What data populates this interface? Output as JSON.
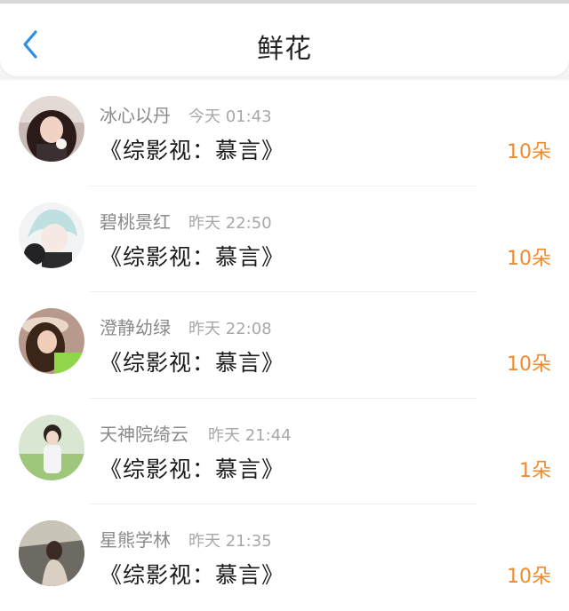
{
  "header": {
    "title": "鲜花",
    "back_icon": "chevron-left-icon",
    "accent": "#2e8ee8"
  },
  "count_color": "#f08a2a",
  "rows": [
    {
      "name": "冰心以丹",
      "time": "今天 01:43",
      "book": "《综影视：慕言》",
      "count": "10朵",
      "avatar": "avatar-icon"
    },
    {
      "name": "碧桃景红",
      "time": "昨天 22:50",
      "book": "《综影视：慕言》",
      "count": "10朵",
      "avatar": "avatar-icon"
    },
    {
      "name": "澄静幼绿",
      "time": "昨天 22:08",
      "book": "《综影视：慕言》",
      "count": "10朵",
      "avatar": "avatar-icon"
    },
    {
      "name": "天神院绮云",
      "time": "昨天 21:44",
      "book": "《综影视：慕言》",
      "count": "1朵",
      "avatar": "avatar-icon"
    },
    {
      "name": "星熊学林",
      "time": "昨天 21:35",
      "book": "《综影视：慕言》",
      "count": "10朵",
      "avatar": "avatar-icon"
    }
  ]
}
